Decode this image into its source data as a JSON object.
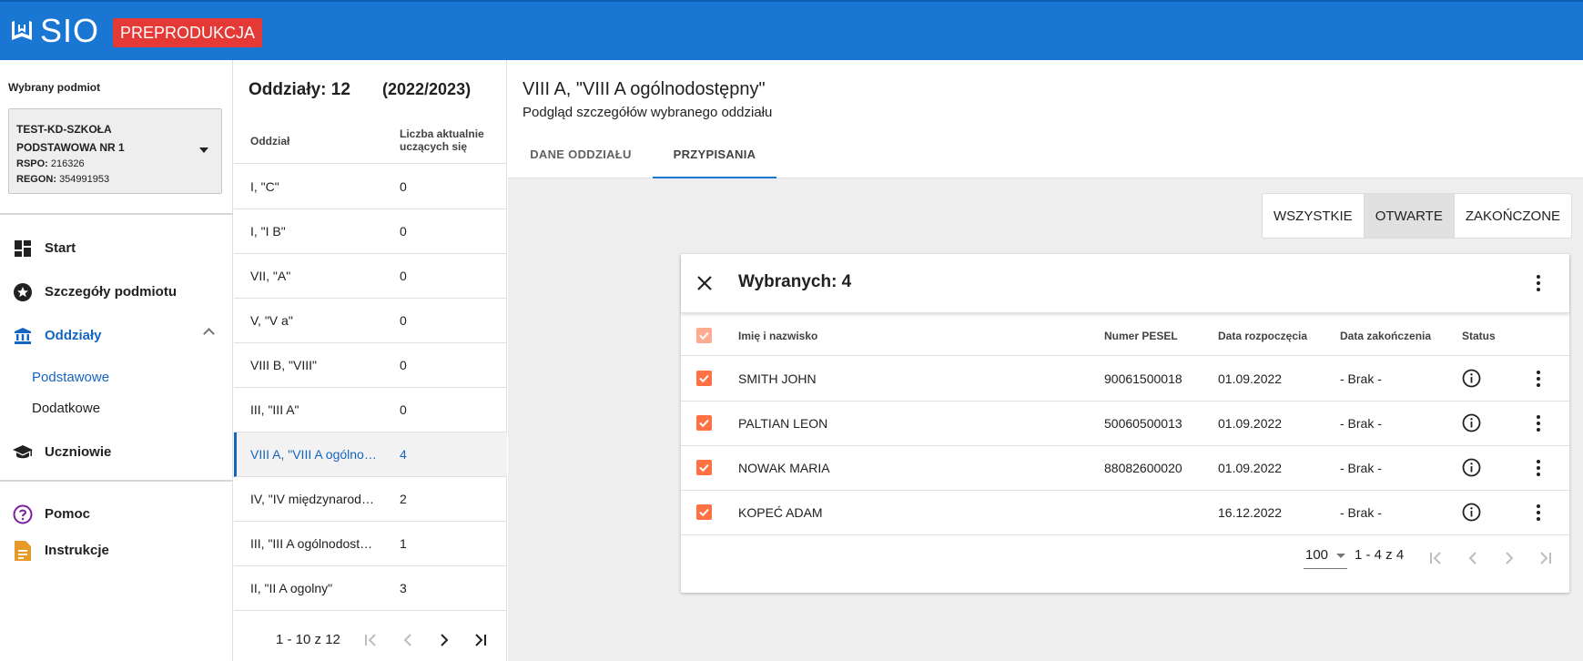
{
  "app": {
    "logo_text": "SIO",
    "env_badge": "PREPRODUKCJA"
  },
  "colors": {
    "topbar": "#1976d2",
    "badge": "#e53935",
    "accent": "#1565c0",
    "checkbox": "#ff7043"
  },
  "entity": {
    "title": "Wybrany podmiot",
    "name": "TEST-KD-SZKOŁA PODSTAWOWA NR 1",
    "rspo_label": "RSPO:",
    "rspo_value": "216326",
    "regon_label": "REGON:",
    "regon_value": "354991953"
  },
  "nav": {
    "start": "Start",
    "details": "Szczegóły podmiotu",
    "classes": "Oddziały",
    "sub_basic": "Podstawowe",
    "sub_additional": "Dodatkowe",
    "students": "Uczniowie",
    "help": "Pomoc",
    "instructions": "Instrukcje"
  },
  "classlist": {
    "title": "Oddziały: 12",
    "year": "(2022/2023)",
    "col_name": "Oddział",
    "col_count": "Liczba aktualnie uczących się",
    "rows": [
      {
        "name": "I, \"C\"",
        "count": "0"
      },
      {
        "name": "I, \"I B\"",
        "count": "0"
      },
      {
        "name": "VII, \"A\"",
        "count": "0"
      },
      {
        "name": "V, \"V a\"",
        "count": "0"
      },
      {
        "name": "VIII B, \"VIII\"",
        "count": "0"
      },
      {
        "name": "III, \"III A\"",
        "count": "0"
      },
      {
        "name": "VIII A, \"VIII A ogólnodostępny\"",
        "count": "4"
      },
      {
        "name": "IV, \"IV międzynarodowy\"",
        "count": "2"
      },
      {
        "name": "III, \"III A ogólnodostępny\"",
        "count": "1"
      },
      {
        "name": "II, \"II A ogolny\"",
        "count": "3"
      }
    ],
    "selected_index": 6,
    "range": "1 - 10 z 12"
  },
  "main": {
    "title": "VIII A, \"VIII A ogólnodostępny\"",
    "subtitle": "Podgląd szczegółów wybranego oddziału",
    "tabs": [
      {
        "label": "DANE ODDZIAŁU",
        "active": false
      },
      {
        "label": "PRZYPISANIA",
        "active": true
      }
    ],
    "filters": [
      {
        "label": "WSZYSTKIE",
        "active": false
      },
      {
        "label": "OTWARTE",
        "active": true
      },
      {
        "label": "ZAKOŃCZONE",
        "active": false
      }
    ]
  },
  "card": {
    "title": "Wybranych: 4",
    "columns": {
      "name": "Imię i nazwisko",
      "pesel": "Numer PESEL",
      "start": "Data rozpoczęcia",
      "end": "Data zakończenia",
      "status": "Status"
    },
    "rows": [
      {
        "name": "SMITH JOHN",
        "pesel": "90061500018",
        "start": "01.09.2022",
        "end": "- Brak -",
        "checked": true
      },
      {
        "name": "PALTIAN LEON",
        "pesel": "50060500013",
        "start": "01.09.2022",
        "end": "- Brak -",
        "checked": true
      },
      {
        "name": "NOWAK MARIA",
        "pesel": "88082600020",
        "start": "01.09.2022",
        "end": "- Brak -",
        "checked": true
      },
      {
        "name": "KOPEĆ ADAM",
        "pesel": "",
        "start": "16.12.2022",
        "end": "- Brak -",
        "checked": true
      }
    ],
    "page_size": "100",
    "range": "1 - 4 z 4"
  }
}
